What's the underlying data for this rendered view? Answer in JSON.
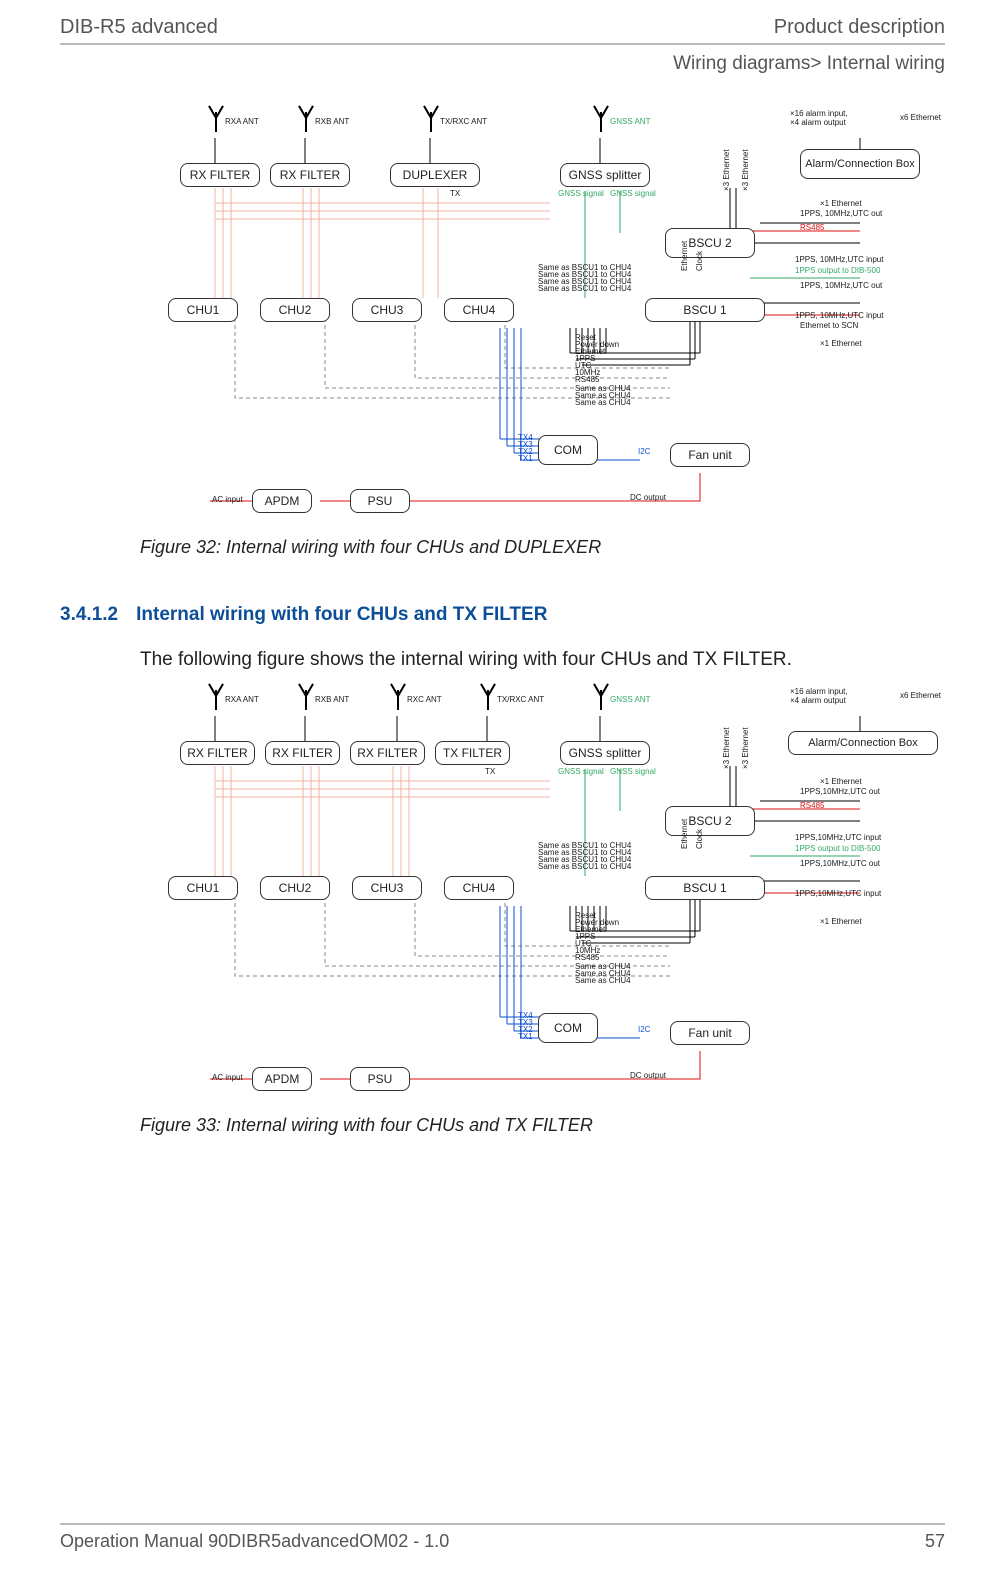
{
  "header": {
    "left": "DIB-R5 advanced",
    "right": "Product description"
  },
  "breadcrumb": "Wiring diagrams> Internal wiring",
  "figure32": {
    "caption": "Figure 32: Internal wiring with four CHUs and DUPLEXER",
    "ant_labels": {
      "rxa": "RXA ANT",
      "rxb": "RXB ANT",
      "txrxc": "TX/RXC ANT",
      "gnss": "GNSS ANT"
    },
    "top_boxes": {
      "rx1": "RX FILTER",
      "rx2": "RX FILTER",
      "dup": "DUPLEXER",
      "gnss": "GNSS splitter",
      "bscu2": "BSCU 2",
      "alarmbox": "Alarm/Connection Box"
    },
    "mid_boxes": {
      "chu1": "CHU1",
      "chu2": "CHU2",
      "chu3": "CHU3",
      "chu4": "CHU4",
      "bscu1": "BSCU 1",
      "com": "COM",
      "fan": "Fan unit",
      "apdm": "APDM",
      "psu": "PSU"
    },
    "labels": {
      "alarm_io": "×16 alarm input,\n×4 alarm output",
      "x6eth": "x6 Ethernet",
      "tx": "TX",
      "gnss_sig_l": "GNSS signal",
      "gnss_sig_r": "GNSS signal",
      "x3eth_a": "×3 Ethernet",
      "x3eth_b": "×3 Ethernet",
      "x1eth_a": "×1 Ethernet",
      "pps_out_a": "1PPS, 10MHz,UTC out",
      "rs485_side": "RS485",
      "pps_in_a": "1PPS, 10MHz,UTC input",
      "dib500": "1PPS output to DIB-500",
      "pps_out_b": "1PPS, 10MHz,UTC out",
      "pps_in_b": "1PPS, 10MHz,UTC input",
      "eth_scn": "Ethernet to SCN",
      "x1eth_b": "×1 Ethernet",
      "eth_v": "Ethernet",
      "clock_v": "Clock",
      "same1": "Same as BSCU1 to CHU4",
      "same2": "Same as BSCU1 to CHU4",
      "same3": "Same as BSCU1 to CHU4",
      "same4": "Same as BSCU1 to CHU4",
      "reset": "Reset",
      "pwr_down": "Power down",
      "eth_s": "Ethernet",
      "pps_s": "1PPS",
      "utc_s": "UTC",
      "mhz_s": "10MHz",
      "rs485_s": "RS485",
      "same_c1": "Same as CHU4",
      "same_c2": "Same as CHU4",
      "same_c3": "Same as CHU4",
      "tx4": "TX4",
      "tx3": "TX3",
      "tx2": "TX2",
      "tx1": "TX1",
      "i2c": "I2C",
      "ac_in": "AC input",
      "dc_out": "DC output"
    }
  },
  "section": {
    "number": "3.4.1.2",
    "title": "Internal wiring with four CHUs and TX FILTER",
    "intro": "The following figure shows the internal wiring with four CHUs and TX FILTER."
  },
  "figure33": {
    "caption": "Figure 33: Internal wiring with four CHUs and TX FILTER",
    "ant_labels": {
      "rxa": "RXA ANT",
      "rxb": "RXB ANT",
      "rxc": "RXC ANT",
      "txrxc": "TX/RXC ANT",
      "gnss": "GNSS ANT"
    },
    "top_boxes": {
      "rx1": "RX FILTER",
      "rx2": "RX FILTER",
      "rx3": "RX FILTER",
      "txf": "TX FILTER",
      "gnss": "GNSS splitter",
      "bscu2": "BSCU 2",
      "alarmbox": "Alarm/Connection Box"
    },
    "mid_boxes": {
      "chu1": "CHU1",
      "chu2": "CHU2",
      "chu3": "CHU3",
      "chu4": "CHU4",
      "bscu1": "BSCU 1",
      "com": "COM",
      "fan": "Fan unit",
      "apdm": "APDM",
      "psu": "PSU"
    },
    "labels": {
      "alarm_io": "×16 alarm input,\n×4 alarm output",
      "x6eth": "x6 Ethernet",
      "tx": "TX",
      "gnss_sig_l": "GNSS signal",
      "gnss_sig_r": "GNSS signal",
      "x3eth_a": "×3 Ethernet",
      "x3eth_b": "×3 Ethernet",
      "x1eth_a": "×1 Ethernet",
      "pps_out_a": "1PPS,10MHz,UTC out",
      "rs485_side": "RS485",
      "pps_in_a": "1PPS,10MHz,UTC input",
      "dib500": "1PPS output to DIB-500",
      "pps_out_b": "1PPS,10MHz,UTC out",
      "pps_in_b": "1PPS,10MHz,UTC input",
      "x1eth_b": "×1 Ethernet",
      "eth_v": "Ethernet",
      "clock_v": "Clock",
      "same1": "Same as BSCU1 to CHU4",
      "same2": "Same as BSCU1 to CHU4",
      "same3": "Same as BSCU1 to CHU4",
      "same4": "Same as BSCU1 to CHU4",
      "reset": "Reset",
      "pwr_down": "Power down",
      "eth_s": "Ethernet",
      "pps_s": "1PPS",
      "utc_s": "UTC",
      "mhz_s": "10MHz",
      "rs485_s": "RS485",
      "same_c1": "Same as CHU4",
      "same_c2": "Same as CHU4",
      "same_c3": "Same as CHU4",
      "tx4": "TX4",
      "tx3": "TX3",
      "tx2": "TX2",
      "tx1": "TX1",
      "i2c": "I2C",
      "ac_in": "AC input",
      "dc_out": "DC output"
    }
  },
  "footer": {
    "left": "Operation Manual 90DIBR5advancedOM02 - 1.0",
    "right": "57"
  }
}
